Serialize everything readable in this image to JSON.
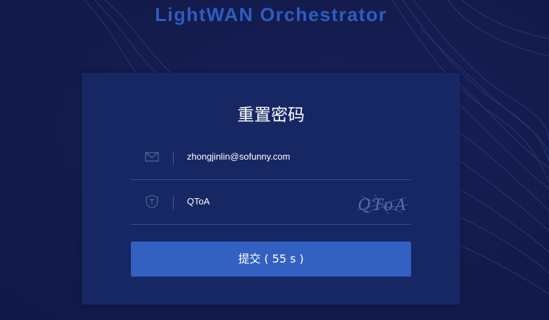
{
  "app": {
    "title": "LightWAN Orchestrator"
  },
  "reset_form": {
    "title": "重置密码",
    "email": {
      "icon": "mail-icon",
      "value": "zhongjinlin@sofunny.com"
    },
    "captcha": {
      "icon": "shield-t-icon",
      "value": "QToA",
      "image_text": "QToA"
    },
    "submit_label": "提交 ( 55 s )"
  },
  "colors": {
    "background": "#131a4b",
    "card": "#172764",
    "accent": "#3361c2",
    "title": "#2e5cc2"
  }
}
